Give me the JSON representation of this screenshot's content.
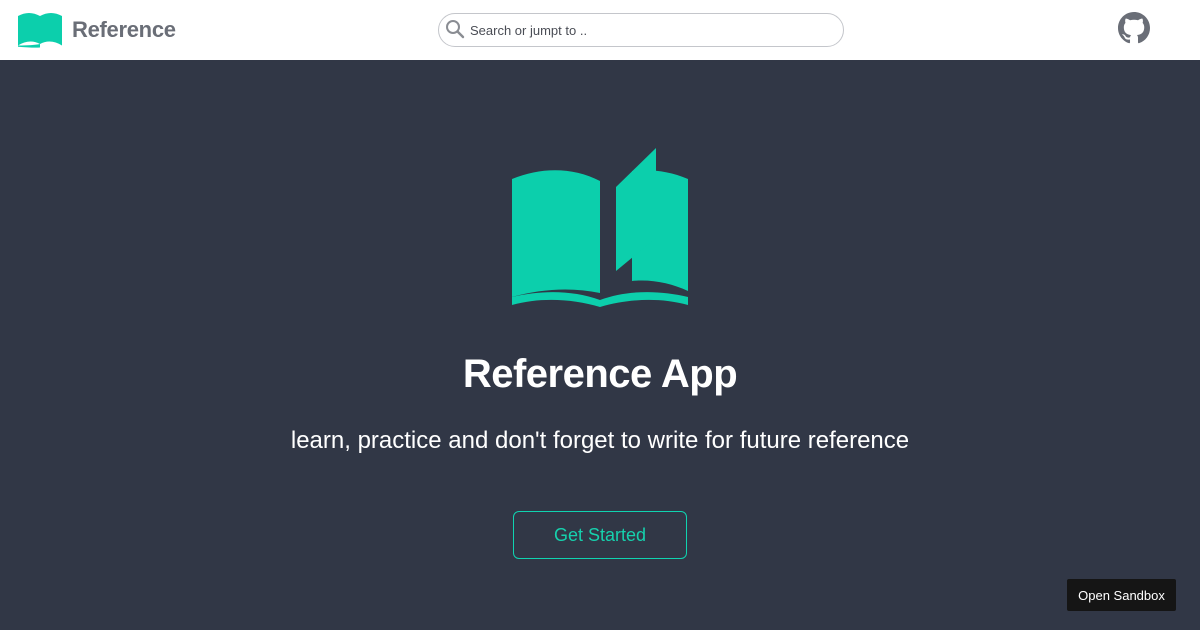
{
  "header": {
    "brand": {
      "name": "Reference",
      "logo_icon": "open-book-icon"
    },
    "search": {
      "placeholder": "Search or jumpt to ..",
      "value": "",
      "icon": "search-icon"
    },
    "github": {
      "icon": "github-icon"
    }
  },
  "hero": {
    "logo_icon": "open-book-icon",
    "title": "Reference App",
    "subtitle": "learn, practice and don't forget to write for future reference",
    "cta_label": "Get Started"
  },
  "sandbox_button": {
    "label": "Open Sandbox"
  },
  "colors": {
    "accent": "#0ccfac",
    "hero_background": "#313746",
    "navbar_background": "#ffffff",
    "brand_text": "#6a6e77",
    "sandbox_background": "#151515"
  }
}
